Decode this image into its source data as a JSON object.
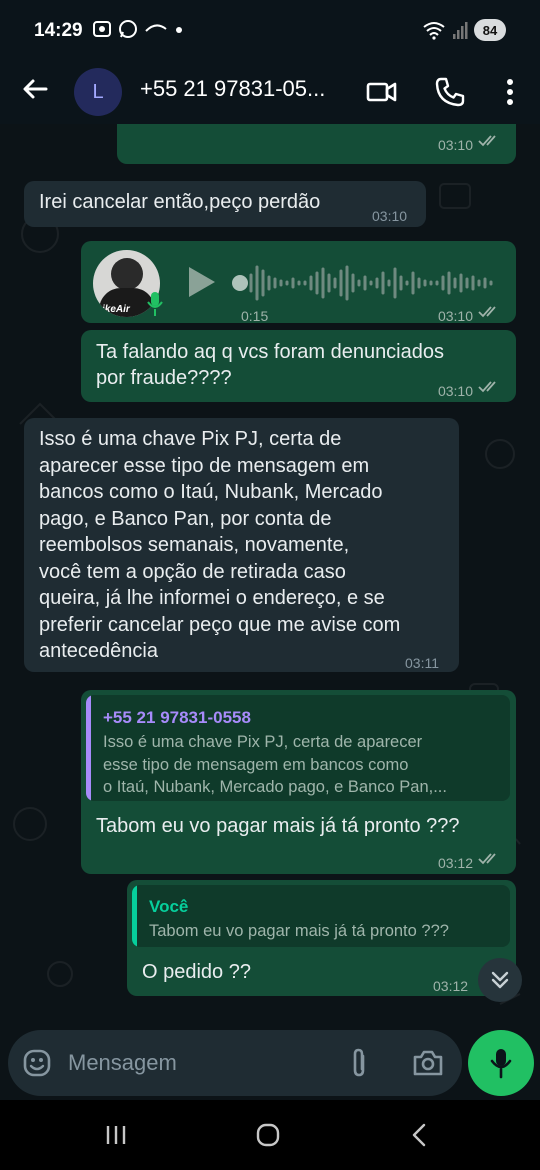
{
  "status": {
    "time": "14:29",
    "battery": "84"
  },
  "header": {
    "avatar_letter": "L",
    "contact_name": "+55 21 97831-05..."
  },
  "messages": {
    "m0": {
      "time": "03:10"
    },
    "m1": {
      "text": "Irei cancelar então,peço perdão",
      "time": "03:10"
    },
    "m2": {
      "duration": "0:15",
      "time": "03:10",
      "avatar_caption": "ikeAir"
    },
    "m3": {
      "line1": "Ta falando aq q vcs foram denunciados",
      "line2": "por fraude????",
      "time": "03:10"
    },
    "m4": {
      "lines": [
        "Isso é uma chave Pix PJ, certa de",
        "aparecer esse tipo de mensagem em",
        "bancos como o Itaú, Nubank, Mercado",
        "pago, e Banco Pan, por conta de",
        "reembolsos semanais, novamente,",
        "você tem a opção de retirada caso",
        "queira, já lhe informei o endereço, e se",
        "preferir cancelar peço que me avise com",
        "antecedência"
      ],
      "time": "03:11"
    },
    "m5": {
      "quote_author": "+55 21 97831-0558",
      "quote_lines": [
        "Isso é uma chave Pix PJ, certa de aparecer",
        "esse tipo de mensagem em bancos como",
        "o Itaú, Nubank, Mercado pago, e Banco Pan,..."
      ],
      "text": "Tabom eu vo pagar mais já tá pronto ???",
      "time": "03:12"
    },
    "m6": {
      "quote_author": "Você",
      "quote_text": "Tabom eu vo pagar mais já tá pronto ???",
      "text": "O pedido ??",
      "time": "03:12"
    }
  },
  "input": {
    "placeholder": "Mensagem"
  },
  "colors": {
    "outgoing_bubble": "#144d37",
    "incoming_bubble": "#1f2c33",
    "accent_green": "#21c063",
    "quote_bar_purple": "#a78bfa",
    "quote_bar_green": "#06cf9c",
    "read_ticks": "#9fb3aa"
  },
  "icons": [
    "back-arrow-icon",
    "video-call-icon",
    "phone-icon",
    "more-vert-icon",
    "play-icon",
    "mic-icon",
    "double-check-icon",
    "emoji-icon",
    "attach-icon",
    "camera-icon",
    "chevron-double-down-icon"
  ]
}
